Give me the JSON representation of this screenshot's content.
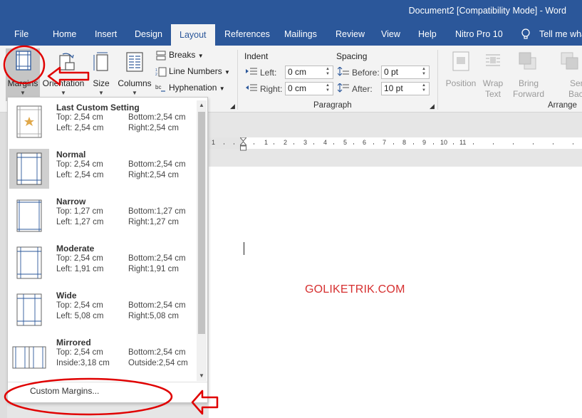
{
  "window": {
    "title": "Document2 [Compatibility Mode]  -  Word"
  },
  "tabs": [
    {
      "label": "File"
    },
    {
      "label": "Home"
    },
    {
      "label": "Insert"
    },
    {
      "label": "Design"
    },
    {
      "label": "Layout"
    },
    {
      "label": "References"
    },
    {
      "label": "Mailings"
    },
    {
      "label": "Review"
    },
    {
      "label": "View"
    },
    {
      "label": "Help"
    },
    {
      "label": "Nitro Pro 10"
    },
    {
      "label": "Tell me wha"
    }
  ],
  "ribbon": {
    "page_setup": {
      "margins": "Margins",
      "orientation": "Orientation",
      "size": "Size",
      "columns": "Columns",
      "breaks": "Breaks",
      "line_numbers": "Line Numbers",
      "hyphenation": "Hyphenation"
    },
    "paragraph": {
      "group_label": "Paragraph",
      "indent_label": "Indent",
      "spacing_label": "Spacing",
      "left_label": "Left:",
      "left_value": "0 cm",
      "right_label": "Right:",
      "right_value": "0 cm",
      "before_label": "Before:",
      "before_value": "0 pt",
      "after_label": "After:",
      "after_value": "10 pt"
    },
    "arrange": {
      "group_label": "Arrange",
      "position": "Position",
      "wrap_text_1": "Wrap",
      "wrap_text_2": "Text",
      "bring_forward_1": "Bring",
      "bring_forward_2": "Forward",
      "send_backward_1": "Send",
      "send_backward_2": "Backward"
    }
  },
  "ruler": {
    "numbers": [
      "1",
      "1",
      "2",
      "3",
      "4",
      "5",
      "6",
      "7",
      "8",
      "9",
      "10",
      "11"
    ]
  },
  "document": {
    "watermark": "GOLIKETRIK.COM"
  },
  "margins_menu": {
    "options": [
      {
        "name": "Last Custom Setting",
        "l1a": "Top:  2,54 cm",
        "l1b": "Bottom:2,54 cm",
        "l2a": "Left:  2,54 cm",
        "l2b": "Right:2,54 cm"
      },
      {
        "name": "Normal",
        "l1a": "Top:  2,54 cm",
        "l1b": "Bottom:2,54 cm",
        "l2a": "Left:  2,54 cm",
        "l2b": "Right:2,54 cm"
      },
      {
        "name": "Narrow",
        "l1a": "Top:  1,27 cm",
        "l1b": "Bottom:1,27 cm",
        "l2a": "Left:  1,27 cm",
        "l2b": "Right:1,27 cm"
      },
      {
        "name": "Moderate",
        "l1a": "Top:  2,54 cm",
        "l1b": "Bottom:2,54 cm",
        "l2a": "Left:  1,91 cm",
        "l2b": "Right:1,91 cm"
      },
      {
        "name": "Wide",
        "l1a": "Top:  2,54 cm",
        "l1b": "Bottom:2,54 cm",
        "l2a": "Left:  5,08 cm",
        "l2b": "Right:5,08 cm"
      },
      {
        "name": "Mirrored",
        "l1a": "Top:  2,54 cm",
        "l1b": "Bottom:2,54 cm",
        "l2a": "Inside:3,18 cm",
        "l2b": "Outside:2,54 cm"
      }
    ],
    "custom": "Custom Margins..."
  },
  "colors": {
    "brand": "#2b579a",
    "annotation": "#e00000",
    "watermark": "#d63030"
  }
}
